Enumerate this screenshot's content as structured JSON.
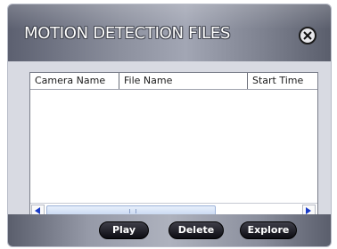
{
  "window": {
    "title": "MOTION DETECTION FILES",
    "close_icon": "circle-x-icon"
  },
  "table": {
    "columns": [
      "Camera Name",
      "File Name",
      "Start Time"
    ],
    "rows": []
  },
  "scrollbar": {
    "left_icon": "arrow-left-icon",
    "right_icon": "arrow-right-icon"
  },
  "actions": {
    "play_label": "Play",
    "delete_label": "Delete",
    "explore_label": "Explore"
  },
  "colors": {
    "accent_blue": "#1a3cc8",
    "button_dark": "#111118"
  }
}
